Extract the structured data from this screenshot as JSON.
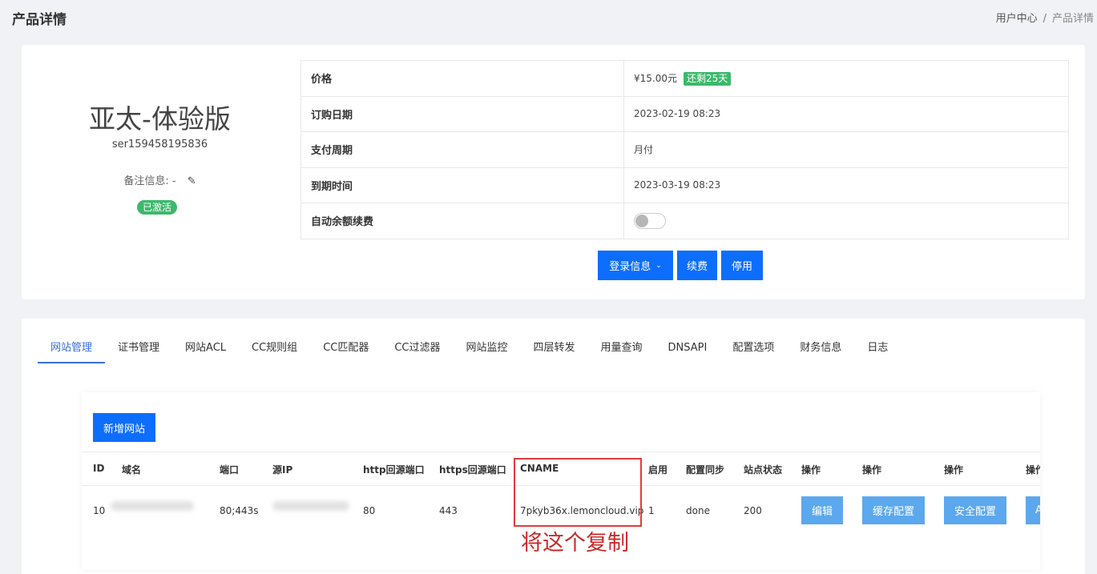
{
  "header": {
    "title": "产品详情",
    "breadcrumb": [
      "用户中心",
      "产品详情"
    ],
    "breadcrumb_sep": "/"
  },
  "product": {
    "name": "亚太-体验版",
    "id": "ser159458195836",
    "remark_label": "备注信息:",
    "remark_value": "-",
    "status": "已激活"
  },
  "info": {
    "price_label": "价格",
    "price_value": "¥15.00元",
    "days_left": "还剩25天",
    "order_date_label": "订购日期",
    "order_date_value": "2023-02-19 08:23",
    "cycle_label": "支付周期",
    "cycle_value": "月付",
    "expire_label": "到期时间",
    "expire_value": "2023-03-19 08:23",
    "auto_renew_label": "自动余额续费",
    "auto_renew_on": false
  },
  "actions": {
    "login_info": "登录信息",
    "renew": "续费",
    "stop": "停用"
  },
  "tabs": [
    "网站管理",
    "证书管理",
    "网站ACL",
    "CC规则组",
    "CC匹配器",
    "CC过滤器",
    "网站监控",
    "四层转发",
    "用量查询",
    "DNSAPI",
    "配置选项",
    "财务信息",
    "日志"
  ],
  "site_table": {
    "add_button": "新增网站",
    "columns": [
      "ID",
      "域名",
      "端口",
      "源IP",
      "http回源端口",
      "https回源端口",
      "CNAME",
      "启用",
      "配置同步",
      "站点状态",
      "操作",
      "操作",
      "操作",
      "操作"
    ],
    "row": {
      "id": "10",
      "port": "80;443s",
      "http_port": "80",
      "https_port": "443",
      "cname": "7pkyb36x.lemoncloud.vip",
      "enabled": "1",
      "sync": "done",
      "status": "200",
      "ops": [
        "编辑",
        "缓存配置",
        "安全配置",
        "ACL"
      ]
    }
  },
  "annotation": "将这个复制",
  "colors": {
    "primary": "#0d6efd",
    "success": "#3cb96b",
    "op_button": "#5ba8ee",
    "annotation": "#e23b3b"
  }
}
